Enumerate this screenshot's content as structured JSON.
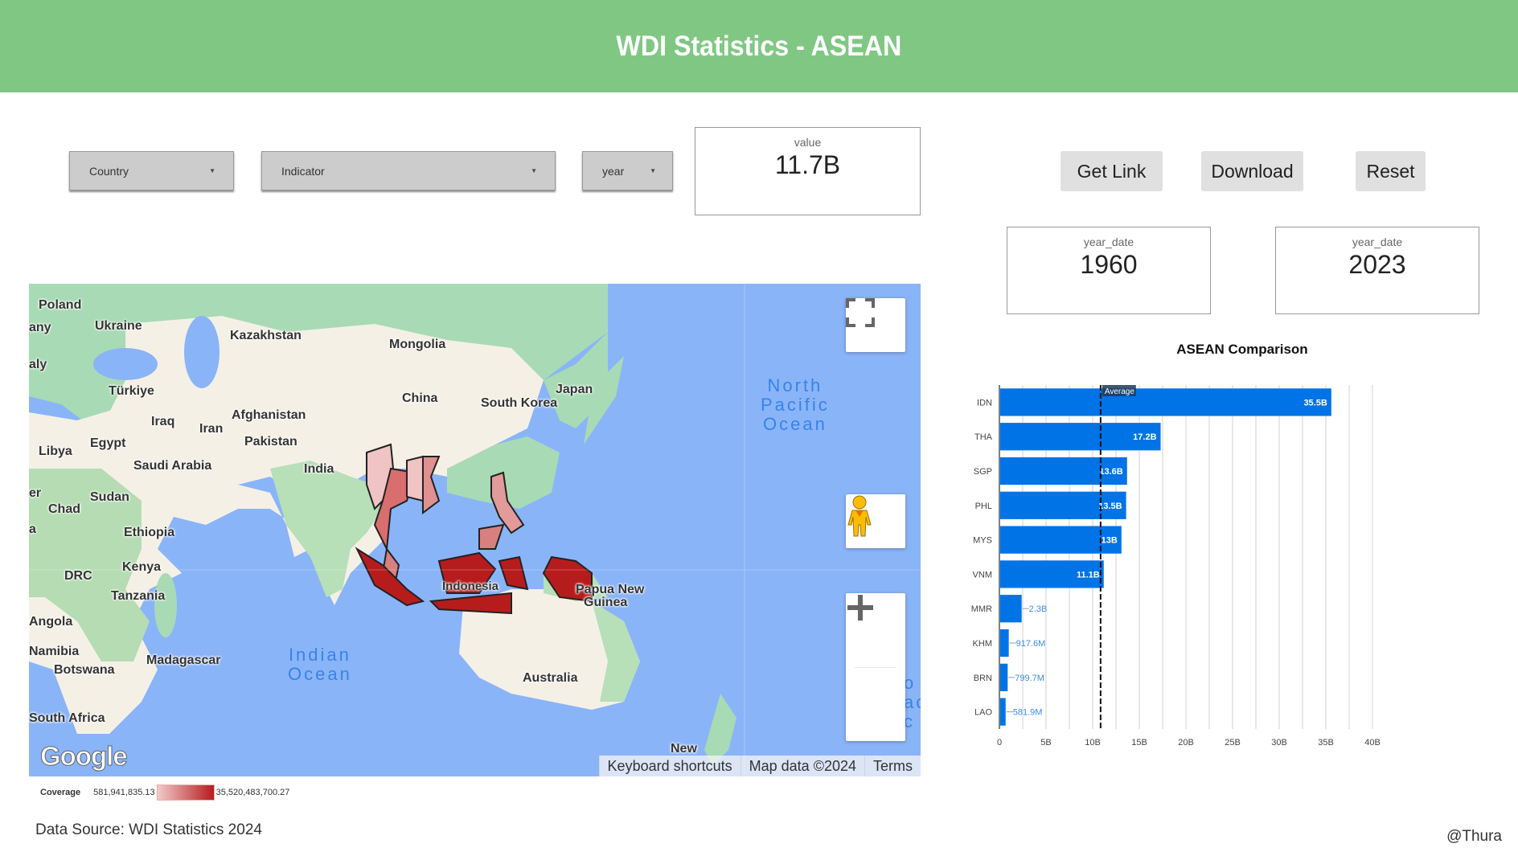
{
  "header": {
    "title": "WDI Statistics - ASEAN"
  },
  "filters": {
    "country": {
      "label": "Country",
      "icon": "caret-down-icon"
    },
    "indicator": {
      "label": "Indicator",
      "icon": "caret-down-icon"
    },
    "year": {
      "label": "year",
      "icon": "caret-down-icon"
    }
  },
  "scorecards": {
    "value": {
      "label": "value",
      "value": "11.7B"
    },
    "year_start": {
      "label": "year_date",
      "value": "1960"
    },
    "year_end": {
      "label": "year_date",
      "value": "2023"
    }
  },
  "buttons": {
    "get_link": "Get Link",
    "download": "Download",
    "reset": "Reset"
  },
  "map": {
    "labels": {
      "poland": "Poland",
      "germany": "any",
      "italy": "aly",
      "ukraine": "Ukraine",
      "kazakhstan": "Kazakhstan",
      "mongolia": "Mongolia",
      "turkiye": "Türkiye",
      "china": "China",
      "japan": "Japan",
      "south_korea": "South Korea",
      "iraq": "Iraq",
      "iran": "Iran",
      "afghanistan": "Afghanistan",
      "libya": "Libya",
      "egypt": "Egypt",
      "pakistan": "Pakistan",
      "saudi_arabia": "Saudi Arabia",
      "india": "India",
      "niger": "er",
      "sudan": "Sudan",
      "chad": "Chad",
      "ethiopia": "Ethiopia",
      "a": "a",
      "kenya": "Kenya",
      "drc": "DRC",
      "tanzania": "Tanzania",
      "indonesia": "Indonesia",
      "png1": "Papua New",
      "png2": "Guinea",
      "angola": "Angola",
      "namibia": "Namibia",
      "madagascar": "Madagascar",
      "botswana": "Botswana",
      "australia": "Australia",
      "south_africa": "South Africa",
      "new_zealand": "New"
    },
    "oceans": {
      "north_pacific": "North\nPacific\nOcean",
      "indian": "Indian\nOcean",
      "south_pacific": "o\nac\nc"
    },
    "attribution": {
      "keyboard": "Keyboard shortcuts",
      "map_data": "Map data ©2024",
      "terms": "Terms"
    },
    "logo": "Google",
    "controls": {
      "fullscreen": "fullscreen-icon",
      "pegman": "pegman-icon",
      "zoom_in": "zoom-in-icon",
      "zoom_out": "zoom-out-icon"
    },
    "legend": {
      "title": "Coverage",
      "min": "581,941,835.13",
      "max": "35,520,483,700.27",
      "min_color": "#f2c9c9",
      "max_color": "#b71c1c"
    }
  },
  "footer": {
    "source": "Data Source: WDI Statistics 2024",
    "author": "@Thura"
  },
  "chart_data": {
    "type": "bar",
    "orientation": "horizontal",
    "title": "ASEAN Comparison",
    "categories": [
      "IDN",
      "THA",
      "SGP",
      "PHL",
      "MYS",
      "VNM",
      "MMR",
      "KHM",
      "BRN",
      "LAO"
    ],
    "values": [
      35500000000,
      17200000000,
      13600000000,
      13500000000,
      13000000000,
      11100000000,
      2300000000,
      917600000,
      799700000,
      581900000
    ],
    "data_labels": [
      "35.5B",
      "17.2B",
      "13.6B",
      "13.5B",
      "13B",
      "11.1B",
      "2.3B",
      "917.6M",
      "799.7M",
      "581.9M"
    ],
    "reference_line": {
      "label": "Average",
      "value": 10850000000
    },
    "xlim": [
      0,
      40000000000
    ],
    "xticks": [
      0,
      5000000000,
      10000000000,
      15000000000,
      20000000000,
      25000000000,
      30000000000,
      35000000000,
      40000000000
    ],
    "xtick_labels": [
      "0",
      "5B",
      "10B",
      "15B",
      "20B",
      "25B",
      "30B",
      "35B",
      "40B"
    ],
    "grid": true,
    "bar_color": "#0073e6",
    "xlabel": "",
    "ylabel": ""
  }
}
